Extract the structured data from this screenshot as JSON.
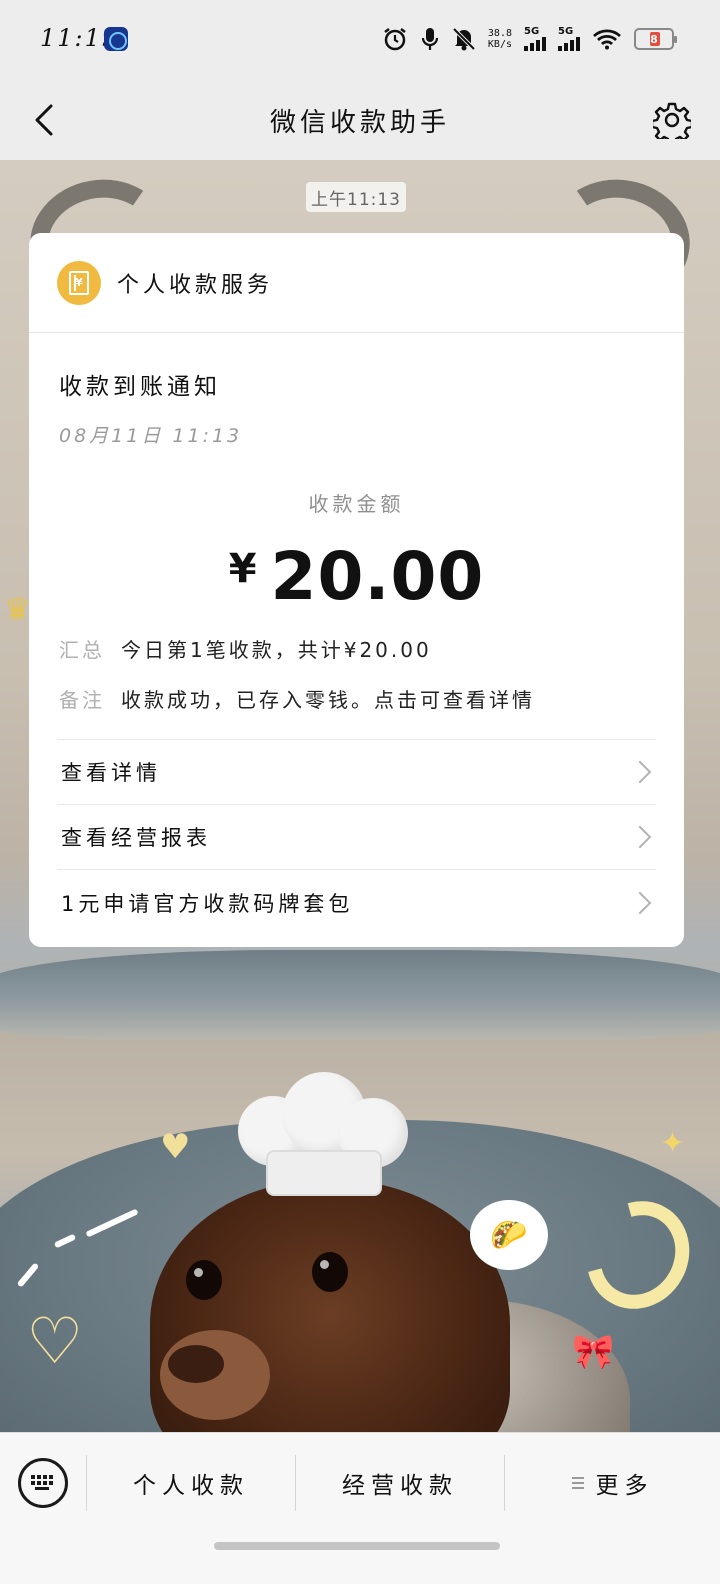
{
  "status_bar": {
    "time": "11:19",
    "net_speed_value": "38.8",
    "net_speed_unit": "KB/s",
    "sim1_label": "5G",
    "sim2_label": "5G",
    "battery_level": "8",
    "icons": [
      "alarm-icon",
      "mic-icon",
      "mute-bell-icon",
      "signal-icon",
      "wifi-icon",
      "battery-icon"
    ]
  },
  "header": {
    "title": "微信收款助手",
    "back_icon": "chevron-left-icon",
    "settings_icon": "gear-icon"
  },
  "chat": {
    "timestamp": "上午11:13",
    "card": {
      "service_name": "个人收款服务",
      "service_icon": "ledger-yen-icon",
      "notice_title": "收款到账通知",
      "notice_date": "08月11日 11:13",
      "amount_label": "收款金额",
      "currency_symbol": "¥",
      "amount": "20.00",
      "summary_key": "汇总",
      "summary_value": "今日第1笔收款，共计¥20.00",
      "remark_key": "备注",
      "remark_value": "收款成功，已存入零钱。点击可查看详情",
      "links": [
        {
          "label": "查看详情"
        },
        {
          "label": "查看经营报表"
        },
        {
          "label": "1元申请官方收款码牌套包"
        }
      ]
    }
  },
  "bottom_menu": {
    "keyboard_icon": "keyboard-icon",
    "items": [
      {
        "label": "个人收款"
      },
      {
        "label": "经营收款"
      },
      {
        "label": "更多"
      }
    ]
  },
  "colors": {
    "accent_gold": "#f0b940",
    "page_bg": "#ededed",
    "card_bg": "#ffffff",
    "muted_text": "#9a9a9a"
  }
}
